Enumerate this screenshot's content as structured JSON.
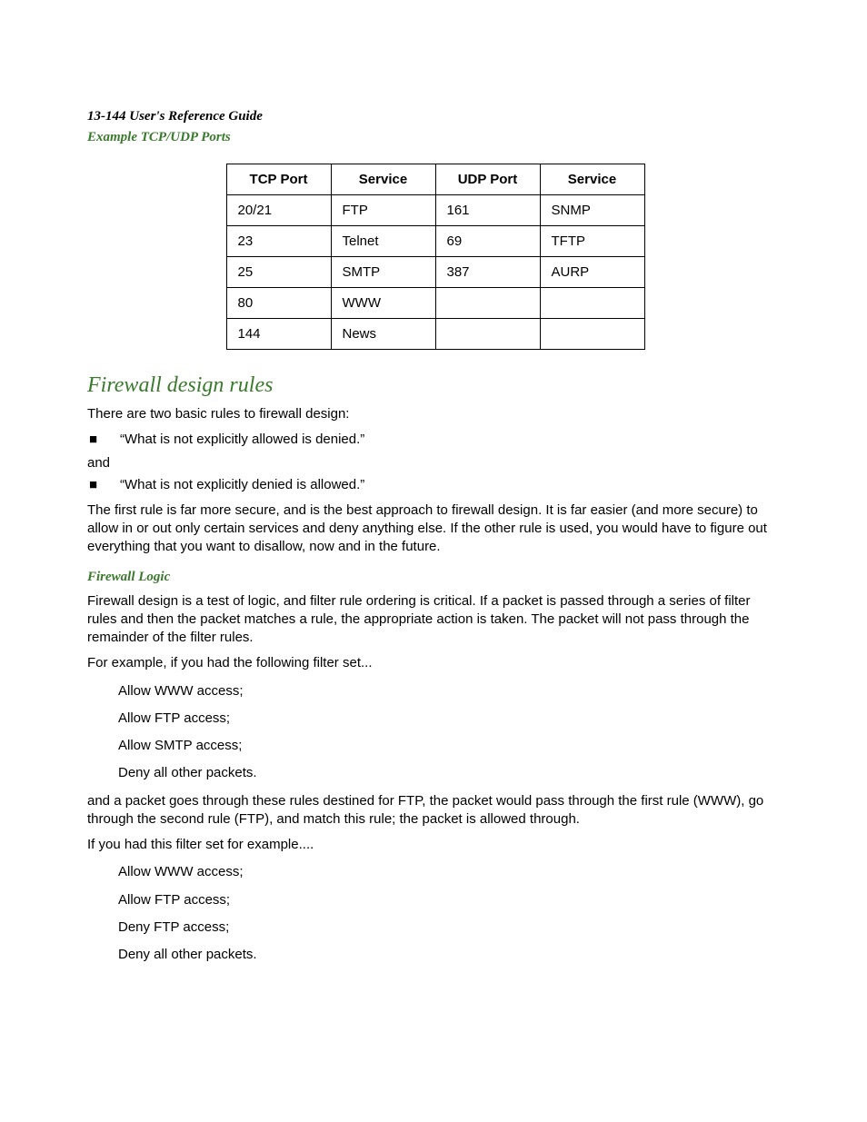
{
  "header": {
    "runhead": "13-144  User's Reference Guide",
    "subhead": "Example TCP/UDP Ports"
  },
  "table": {
    "headers": [
      "TCP Port",
      "Service",
      "UDP Port",
      "Service"
    ],
    "rows": [
      [
        "20/21",
        "FTP",
        "161",
        "SNMP"
      ],
      [
        "23",
        "Telnet",
        "69",
        "TFTP"
      ],
      [
        "25",
        "SMTP",
        "387",
        "AURP"
      ],
      [
        "80",
        "WWW",
        "",
        ""
      ],
      [
        "144",
        "News",
        "",
        ""
      ]
    ]
  },
  "section1": {
    "title": "Firewall design rules",
    "intro": "There are two basic rules to firewall design:",
    "bullet1": "“What is not explicitly allowed is denied.”",
    "and": "and",
    "bullet2": "“What is not explicitly denied is allowed.”",
    "para": "The first rule is far more secure, and is the best approach to firewall design. It is far easier (and more secure) to allow in or out only certain services and deny anything else. If the other rule is used, you would have to figure out everything that you want to disallow, now and in the future."
  },
  "section2": {
    "title": "Firewall Logic",
    "para1": "Firewall design is a test of logic, and filter rule ordering is critical. If a packet is passed through a series of filter rules and then the packet matches a rule, the appropriate action is taken. The packet will not pass through the remainder of the filter rules.",
    "para2": "For example, if you had the following filter set...",
    "list1": [
      "Allow WWW access;",
      "Allow FTP access;",
      "Allow SMTP access;",
      "Deny all other packets."
    ],
    "para3": "and a packet goes through these rules destined for FTP, the packet would pass through the first rule (WWW), go through the second rule (FTP), and match this rule; the packet is allowed through.",
    "para4": "If you had this filter set for example....",
    "list2": [
      "Allow WWW access;",
      "Allow FTP access;",
      "Deny FTP access;",
      "Deny all other packets."
    ]
  },
  "glyphs": {
    "square": "■"
  }
}
